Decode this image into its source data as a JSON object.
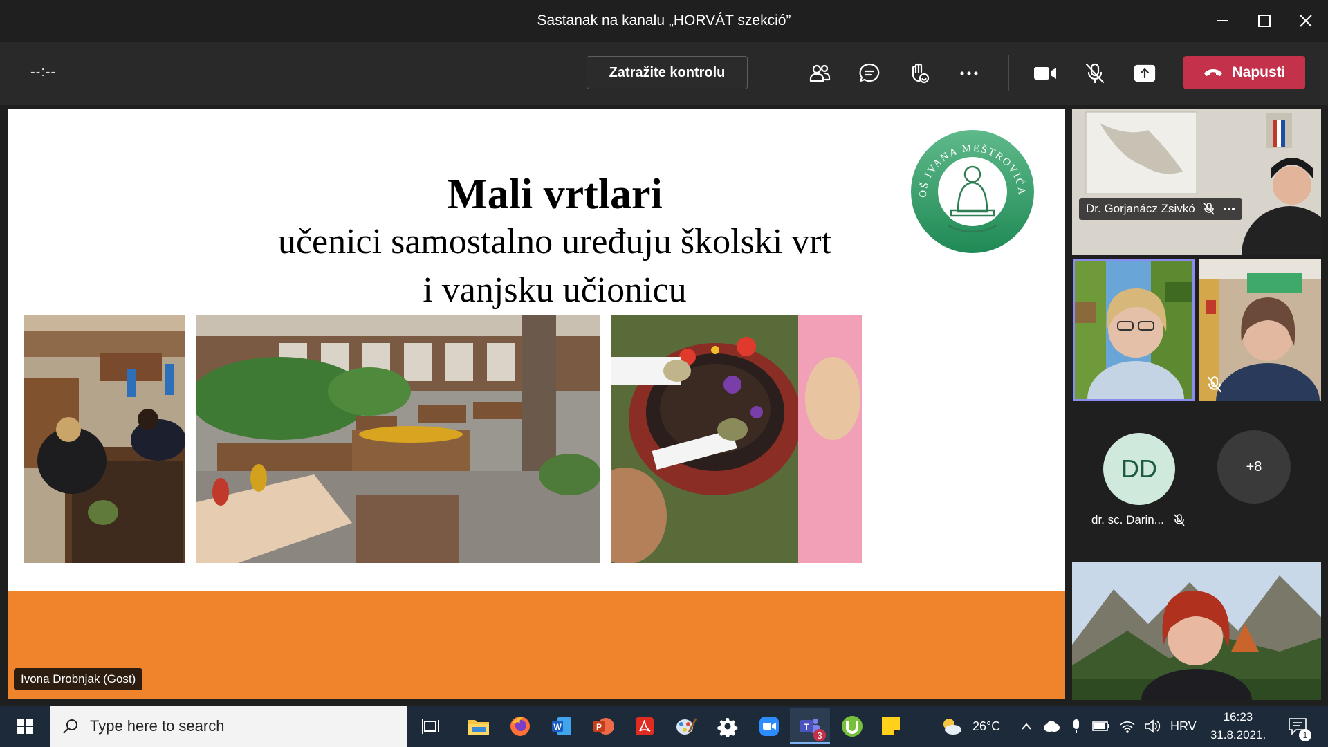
{
  "window": {
    "title": "Sastanak na kanalu „HORVÁT szekció”"
  },
  "toolbar": {
    "timer": "--:--",
    "request_control_label": "Zatražite kontrolu",
    "leave_label": "Napusti",
    "leave_color": "#c4314b"
  },
  "slide": {
    "title": "Mali vrtlari",
    "subtitle_line1": "učenici samostalno uređuju školski vrt",
    "subtitle_line2": "i vanjsku učionicu",
    "logo_text": "OŠ IVANA MEŠTROVIĆA",
    "presenter": "Ivona Drobnjak (Gost)",
    "accent_color": "#f0842c"
  },
  "participants": {
    "tile1_name": "Dr. Gorjanácz Zsivkó",
    "avatar_initials": "DD",
    "avatar_name": "dr. sc. Darin...",
    "overflow_count": "+8"
  },
  "taskbar": {
    "search_placeholder": "Type here to search",
    "weather": "26°C",
    "language": "HRV",
    "time": "16:23",
    "date": "31.8.2021.",
    "teams_badge": "3",
    "notification_badge": "1"
  }
}
